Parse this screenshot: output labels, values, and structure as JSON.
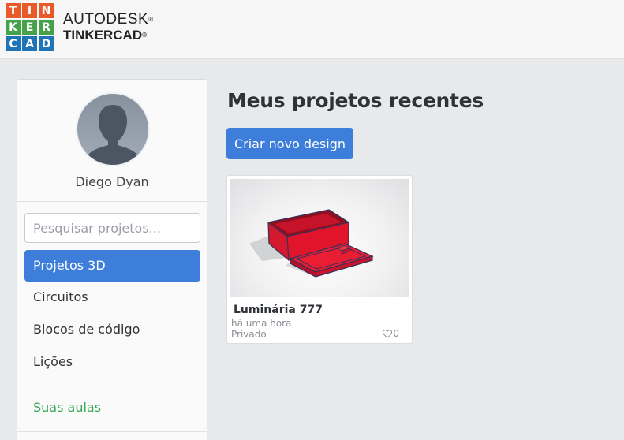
{
  "brand": {
    "logo_letters": [
      "T",
      "I",
      "N",
      "K",
      "E",
      "R",
      "C",
      "A",
      "D"
    ],
    "logo_colors": [
      "#e95a2b",
      "#e95a2b",
      "#e95a2b",
      "#45a24b",
      "#45a24b",
      "#45a24b",
      "#1f73b7",
      "#1f73b7",
      "#1f73b7"
    ],
    "line1": "AUTODESK",
    "line2": "TINKERCAD",
    "mark": "®"
  },
  "sidebar": {
    "user_name": "Diego Dyan",
    "search_placeholder": "Pesquisar projetos...",
    "items": [
      {
        "label": "Projetos 3D",
        "active": true
      },
      {
        "label": "Circuitos"
      },
      {
        "label": "Blocos de código"
      },
      {
        "label": "Lições"
      }
    ],
    "classes_link": "Suas aulas"
  },
  "main": {
    "title": "Meus projetos recentes",
    "new_design_button": "Criar novo design"
  },
  "projects": [
    {
      "title": "Luminária 777",
      "time": "há uma hora",
      "visibility": "Privado",
      "likes": "0"
    }
  ],
  "colors": {
    "accent": "#3d7edb",
    "green": "#35a853",
    "model_red": "#e0152c"
  }
}
